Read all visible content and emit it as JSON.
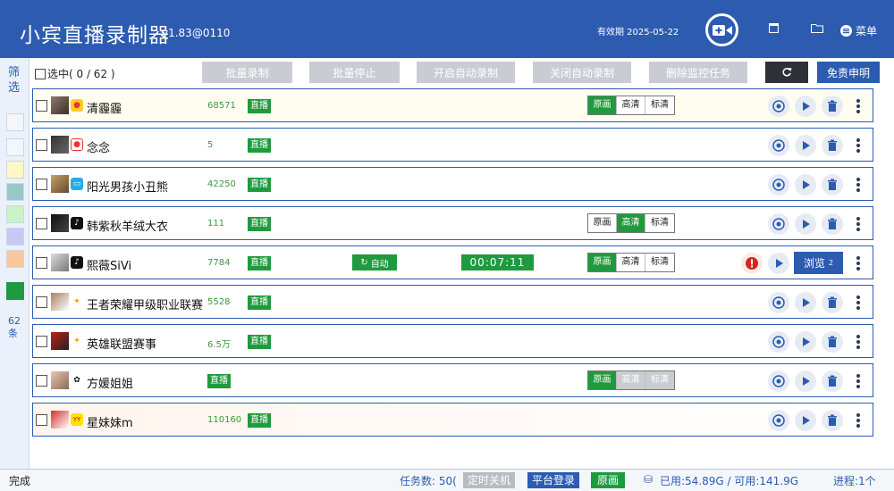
{
  "header": {
    "title": "小宾直播录制器",
    "version": "v1.83@0110",
    "expiry": "有效期 2025-05-22",
    "menu": "菜单"
  },
  "sidebar": {
    "filter": "筛选",
    "count": "62条"
  },
  "toolbar": {
    "selected": "选中( 0  /  62 )",
    "batch_record": "批量录制",
    "batch_stop": "批量停止",
    "auto_on": "开启自动录制",
    "auto_off": "关闭自动录制",
    "delete_monitor": "删除监控任务",
    "disclaimer": "免责申明"
  },
  "quality": {
    "original": "原画",
    "high": "高清",
    "standard": "标清"
  },
  "rows": [
    {
      "name": "清霾霾",
      "count": "68571",
      "status": "直播"
    },
    {
      "name": "念念",
      "count": "5",
      "status": "直播"
    },
    {
      "name": "阳光男孩小丑熊",
      "count": "42250",
      "status": "直播"
    },
    {
      "name": "韩紫秋羊绒大衣",
      "count": "111",
      "status": "直播"
    },
    {
      "name": "熙薇SiVi",
      "count": "7784",
      "status": "直播",
      "auto": "自动",
      "timer": "00:07:11",
      "browse": "浏览",
      "browse_count": "2"
    },
    {
      "name": "王者荣耀甲级职业联赛",
      "count": "5528",
      "status": "直播"
    },
    {
      "name": "英雄联盟赛事",
      "count": "6.5万",
      "status": "直播"
    },
    {
      "name": "方媛姐姐",
      "count": "",
      "status": "直播"
    },
    {
      "name": "星妹妹m",
      "count": "110160",
      "status": "直播"
    }
  ],
  "status": {
    "done": "完成",
    "tasks": "任务数: 50(",
    "shutdown": "定时关机",
    "login": "平台登录",
    "orig": "原画",
    "disk": "已用:54.89G / 可用:141.9G",
    "proc": "进程:1个"
  },
  "colors": {
    "accent": "#2c5bb0",
    "live": "#1f9a3e",
    "disabled": "#c9cdd3"
  }
}
